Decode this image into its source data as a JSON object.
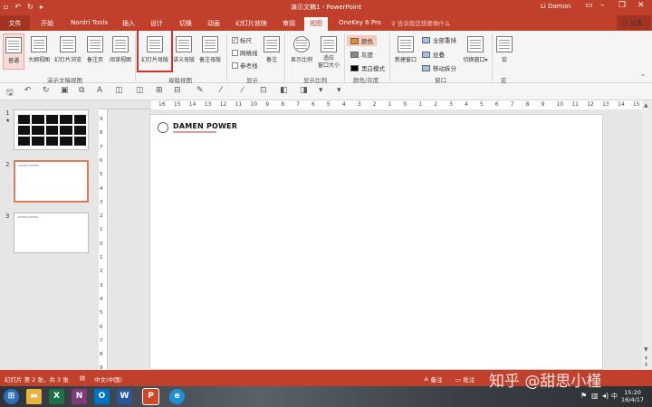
{
  "window": {
    "title": "演示文稿1 - PowerPoint",
    "user": "Li Damon"
  },
  "tabs": {
    "file": "文件",
    "items": [
      "开始",
      "Nordri Tools",
      "插入",
      "设计",
      "切换",
      "动画",
      "幻灯片放映",
      "审阅",
      "视图",
      "OneKey 6 Pro"
    ],
    "active": "视图",
    "tell_me": "告诉我您想要做什么",
    "share": "共享"
  },
  "ribbon": {
    "views": {
      "normal": "普通",
      "outline": "大纲视图",
      "sorter": "幻灯片浏览",
      "notes_page": "备注页",
      "reading": "阅读视图"
    },
    "master": {
      "slide_master": "幻灯片母版",
      "handout_master": "讲义母版",
      "notes_master": "备注母版"
    },
    "show": {
      "ruler": "标尺",
      "gridlines": "网格线",
      "guides": "参考线",
      "notes": "备注"
    },
    "zoom": {
      "zoom": "显示比例",
      "fit": "适应",
      "fit2": "窗口大小"
    },
    "color": {
      "color": "颜色",
      "grayscale": "灰度",
      "bw": "黑白模式"
    },
    "window": {
      "new_window": "新建窗口",
      "arrange_all": "全部重排",
      "cascade": "层叠",
      "move_split": "移动拆分",
      "switch": "切换窗口"
    },
    "macros": {
      "macros": "宏"
    },
    "groups": [
      "演示文稿视图",
      "母版视图",
      "显示",
      "显示比例",
      "颜色/灰度",
      "窗口",
      "宏"
    ]
  },
  "hruler": [
    "16",
    "15",
    "14",
    "13",
    "12",
    "11",
    "10",
    "9",
    "8",
    "7",
    "6",
    "5",
    "4",
    "3",
    "2",
    "1",
    "0",
    "1",
    "2",
    "3",
    "4",
    "5",
    "6",
    "7",
    "8",
    "9",
    "10",
    "11",
    "12",
    "13",
    "14",
    "15",
    "16"
  ],
  "vruler": [
    "9",
    "8",
    "7",
    "6",
    "5",
    "4",
    "3",
    "2",
    "1",
    "0",
    "1",
    "2",
    "3",
    "4",
    "5",
    "6",
    "7",
    "8",
    "9"
  ],
  "thumbs": [
    {
      "num": "1"
    },
    {
      "num": "2",
      "mini": "DAMEN POWER"
    },
    {
      "num": "3",
      "mini": "DAMEN POWER"
    }
  ],
  "slide": {
    "brand": "DAMEN POWER"
  },
  "status": {
    "slide_info": "幻灯片 第 2 张，共 3 张",
    "lang": "中文(中国)",
    "notes": "备注",
    "comments": "批注"
  },
  "watermark": "知乎 @甜思小槿",
  "clock": {
    "time": "15:20",
    "date": "16/4/17"
  }
}
